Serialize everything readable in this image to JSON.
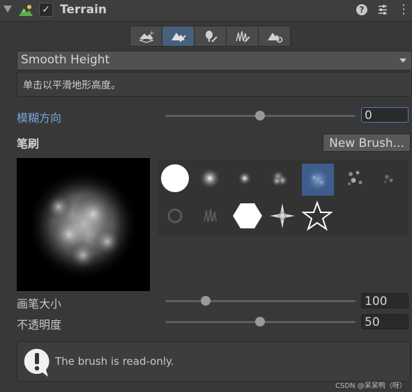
{
  "header": {
    "title": "Terrain",
    "enabled_mark": "✓",
    "help_symbol": "?",
    "menu_symbol": "⋮"
  },
  "toolbar": {
    "tools": [
      {
        "icon": "create-neighbor-terrains-icon",
        "active": false
      },
      {
        "icon": "paint-terrain-icon",
        "active": true
      },
      {
        "icon": "paint-trees-icon",
        "active": false
      },
      {
        "icon": "paint-details-icon",
        "active": false
      },
      {
        "icon": "terrain-settings-icon",
        "active": false
      }
    ]
  },
  "tool_dropdown": {
    "value": "Smooth Height"
  },
  "description": {
    "text": "单击以平滑地形高度。"
  },
  "blur_direction": {
    "label": "模糊方向",
    "value": "0",
    "fraction": 0.5
  },
  "brushes": {
    "label": "笔刷",
    "new_button": "New Brush..."
  },
  "brush_size": {
    "label": "画笔大小",
    "value": "100",
    "fraction": 0.21
  },
  "opacity": {
    "label": "不透明度",
    "value": "50",
    "fraction": 0.5
  },
  "alert": {
    "text": "The brush is read-only.",
    "icon": "exclamation-bubble-icon"
  },
  "watermark": {
    "text": "CSDN @呆呆鸭（呀）"
  },
  "colors": {
    "accent": "#46607c",
    "selected_brush": "#3d5e8d",
    "focused_label": "#7ba4dc"
  }
}
